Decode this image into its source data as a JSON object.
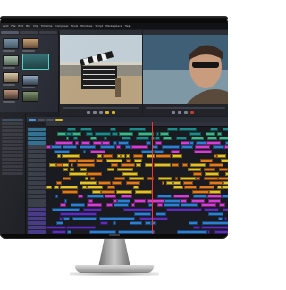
{
  "app": {
    "menu": [
      "Avid",
      "File",
      "Edit",
      "Bin",
      "Clip",
      "Timeline",
      "Composer",
      "Tools",
      "Windows",
      "Script",
      "Marketplace",
      "Help"
    ]
  },
  "device": {
    "frame_color": "#0a0a0a",
    "stand_color": "#b5b5b5"
  },
  "colors": {
    "ui_background": "#1c1d22",
    "playhead": "#ff3030",
    "video_clip_blue": "#2f7fd1",
    "audio_clip_purple": "#5b2fb6",
    "clip_magenta": "#d23fd2",
    "clip_yellow": "#e3c12a",
    "clip_orange": "#e07b1d",
    "clip_green": "#3fb58a",
    "track_teal": "#1f8a8c"
  },
  "icons": {
    "source_subject": "film-clapperboard",
    "record_subject": "man-with-sunglasses"
  }
}
